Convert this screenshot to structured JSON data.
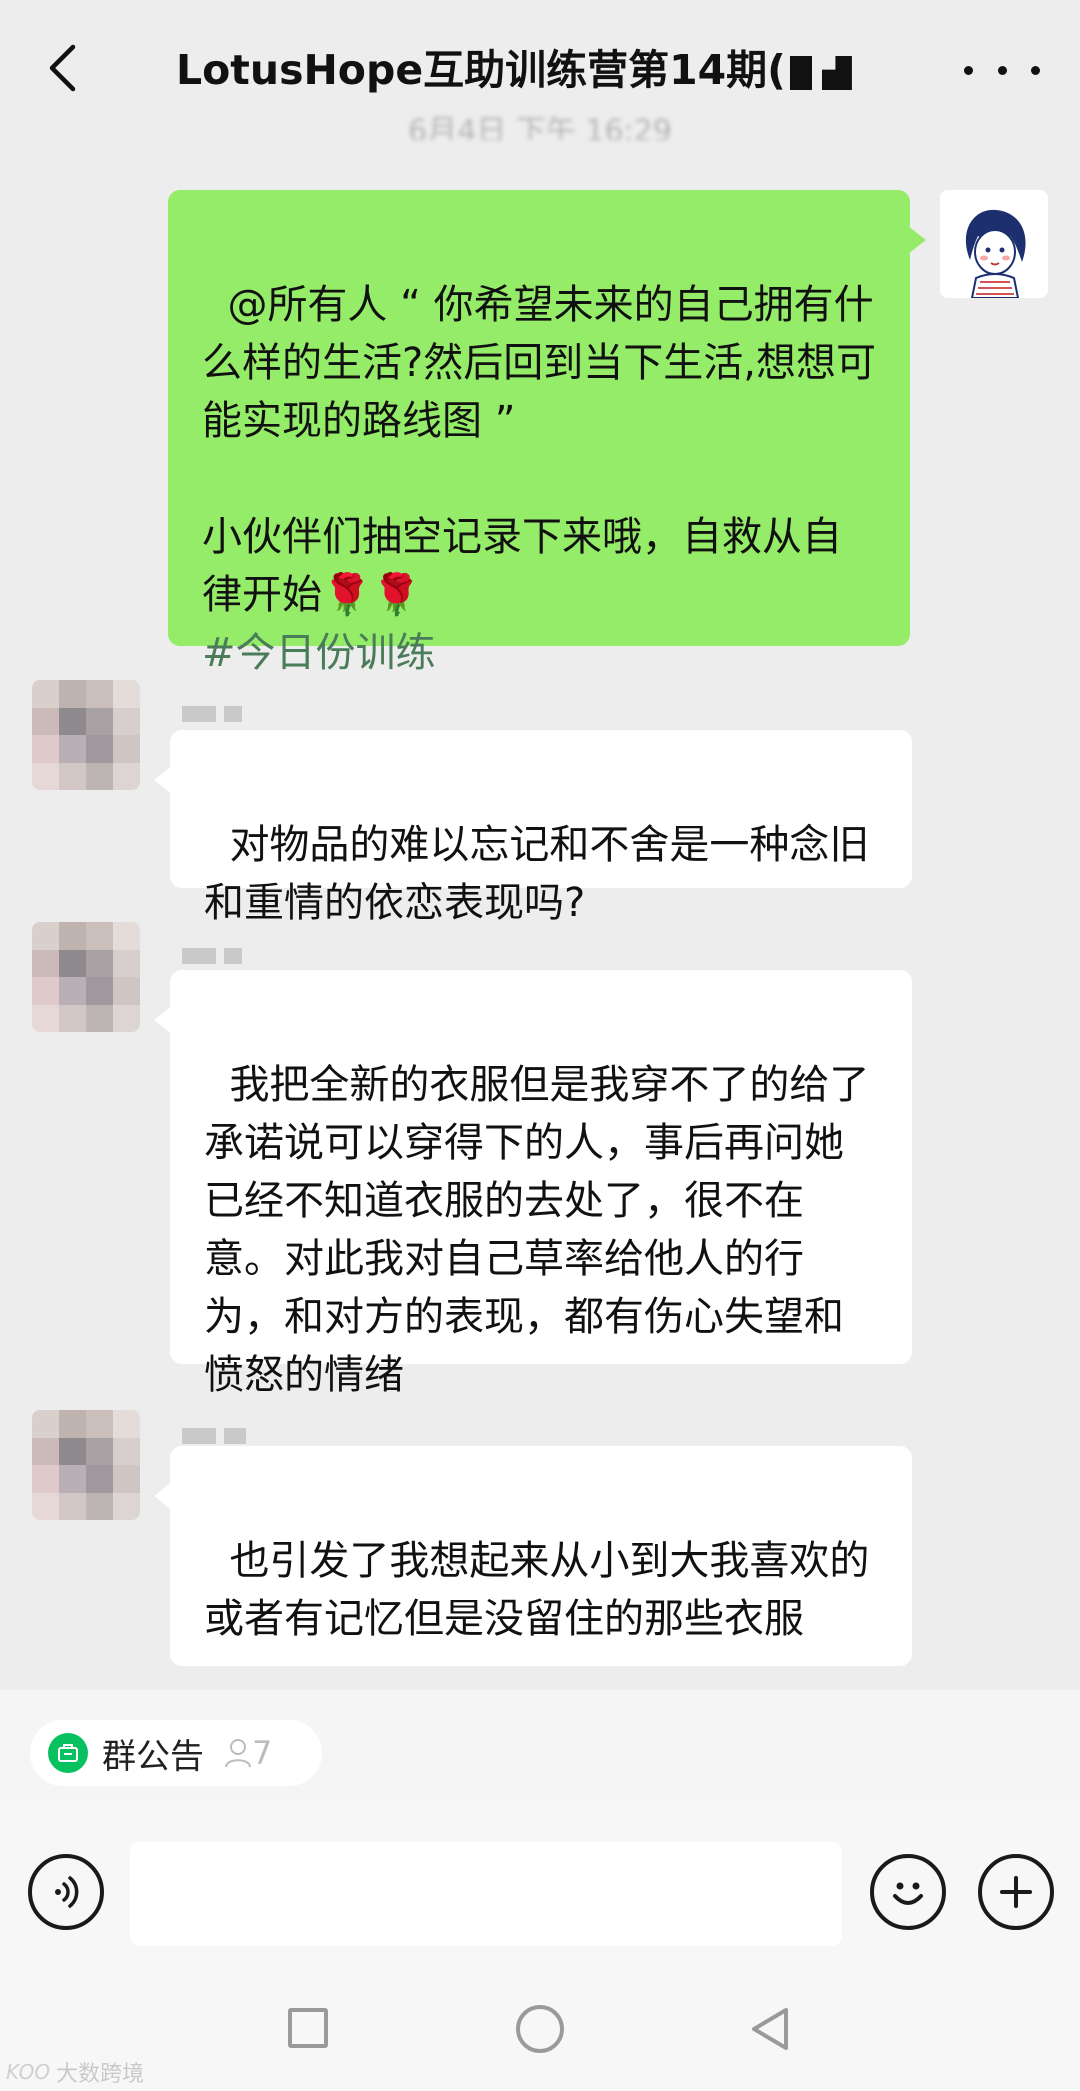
{
  "header": {
    "title": "LotusHope互助训练营第14期(",
    "timestamp": "6月4日 下午 16:29"
  },
  "messages": [
    {
      "sender": "me",
      "mention": "@所有人 “ 你希望未来的自己拥有什么样的生活?然后回到当下生活,想想可能实现的路线图 ”",
      "body": "小伙伴们抽空记录下来哦，自救从自律开始🌹🌹",
      "hashtag": "#今日份训练"
    },
    {
      "sender": "member",
      "text": "对物品的难以忘记和不舍是一种念旧和重情的依恋表现吗?"
    },
    {
      "sender": "member",
      "text": "我把全新的衣服但是我穿不了的给了承诺说可以穿得下的人，事后再问她已经不知道衣服的去处了，很不在意。对此我对自己草率给他人的行为，和对方的表现，都有伤心失望和愤怒的情绪"
    },
    {
      "sender": "member",
      "text": "也引发了我想起来从小到大我喜欢的或者有记忆但是没留住的那些衣服"
    }
  ],
  "notice": {
    "label": "群公告",
    "member_count": "7",
    "icon": "announcement-icon"
  },
  "input": {
    "value": "",
    "placeholder": ""
  },
  "watermark": {
    "logo": "KOO",
    "text": "大数跨境"
  },
  "colors": {
    "my_bubble": "#95ec69",
    "their_bubble": "#ffffff",
    "background": "#ededed",
    "hashtag": "#4a7c59",
    "notice_icon": "#07c160"
  }
}
